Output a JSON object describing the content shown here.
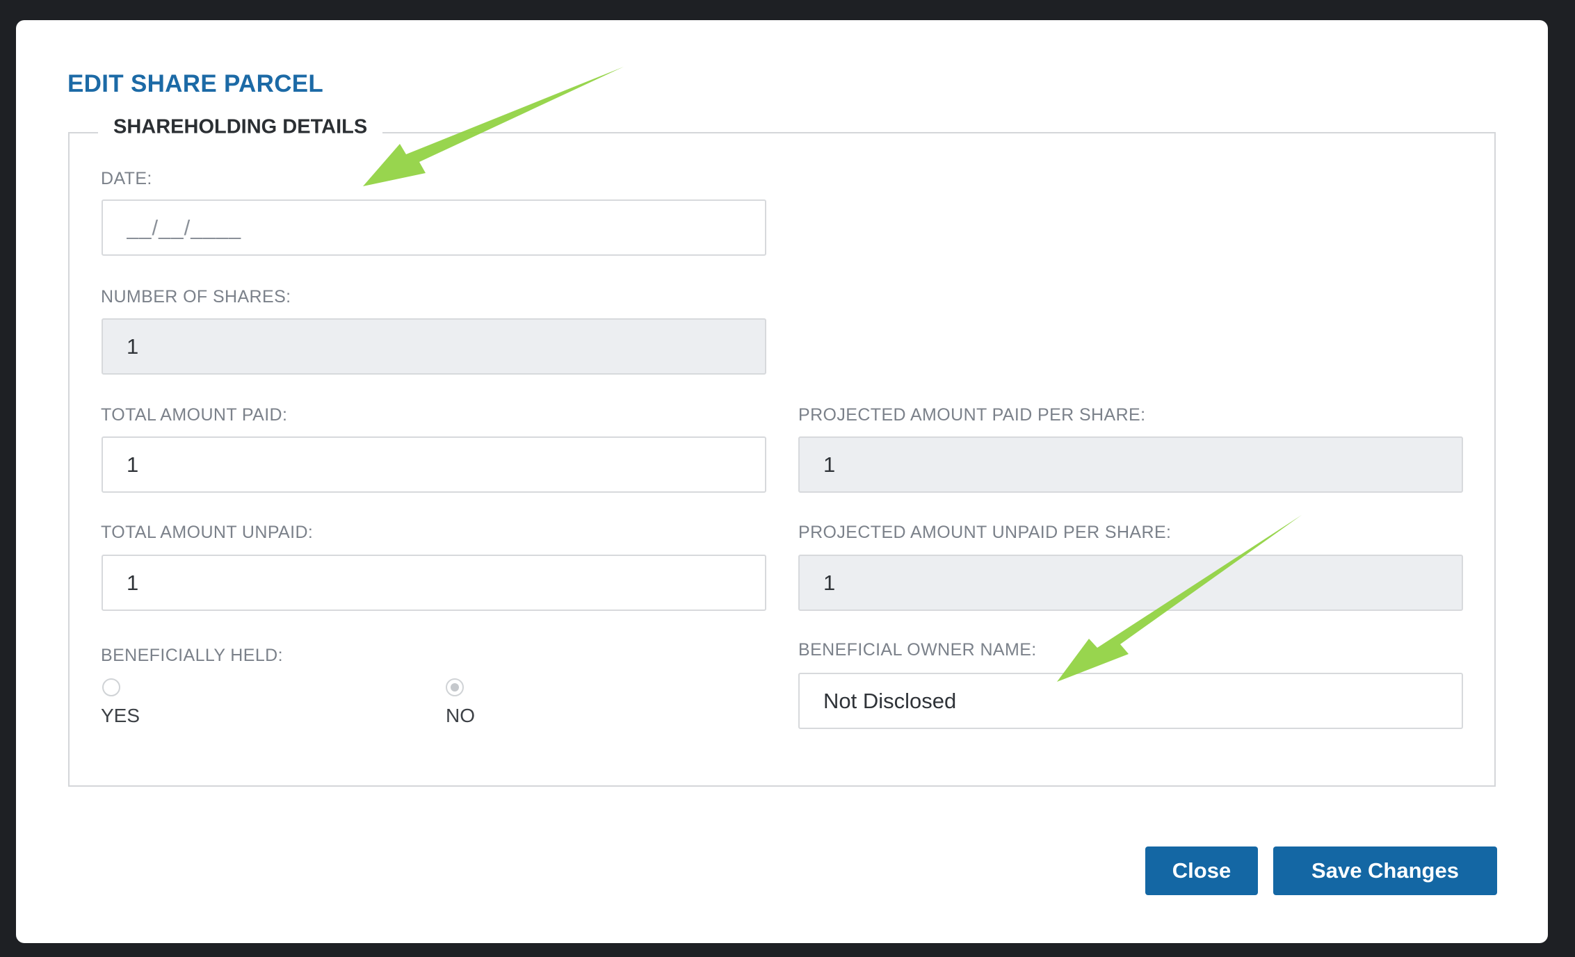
{
  "modal": {
    "title": "EDIT SHARE PARCEL"
  },
  "section": {
    "legend": "SHAREHOLDING DETAILS"
  },
  "fields": {
    "date": {
      "label": "DATE:",
      "value": "__/__/____"
    },
    "number_of_shares": {
      "label": "NUMBER OF SHARES:",
      "value": "1"
    },
    "total_amount_paid": {
      "label": "TOTAL AMOUNT PAID:",
      "value": "1"
    },
    "projected_amount_paid_per_share": {
      "label": "PROJECTED AMOUNT PAID PER SHARE:",
      "value": "1"
    },
    "total_amount_unpaid": {
      "label": "TOTAL AMOUNT UNPAID:",
      "value": "1"
    },
    "projected_amount_unpaid_per_share": {
      "label": "PROJECTED AMOUNT UNPAID PER SHARE:",
      "value": "1"
    },
    "beneficially_held": {
      "label": "BENEFICIALLY HELD:",
      "options": [
        "YES",
        "NO"
      ],
      "selected": "NO"
    },
    "beneficial_owner_name": {
      "label": "BENEFICIAL OWNER NAME:",
      "value": "Not Disclosed"
    }
  },
  "buttons": {
    "close": "Close",
    "save": "Save Changes"
  },
  "colors": {
    "accent": "#1467a4",
    "title": "#1c6aa6",
    "annotation_arrow": "#8fd13f"
  }
}
